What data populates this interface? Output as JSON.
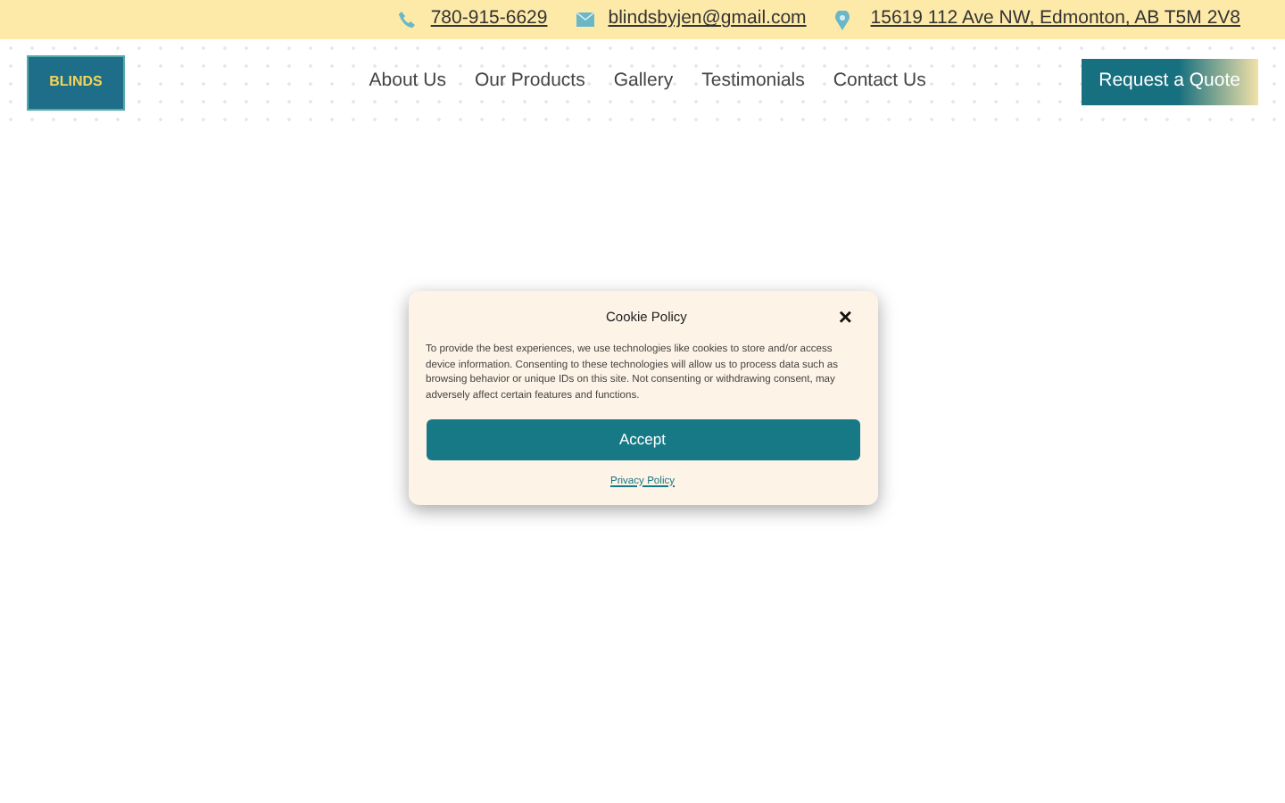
{
  "top_bar": {
    "phone": "780-915-6629",
    "email": "blindsbyjen@gmail.com",
    "address": "15619 112 Ave NW, Edmonton, AB T5M 2V8"
  },
  "logo": {
    "text": "BLINDS"
  },
  "nav": [
    {
      "label": "About Us"
    },
    {
      "label": "Our Products"
    },
    {
      "label": "Gallery"
    },
    {
      "label": "Testimonials"
    },
    {
      "label": "Contact Us"
    }
  ],
  "cta_button": "Request a Quote",
  "cookie_dialog": {
    "title": "Cookie Policy",
    "close": "×",
    "body": "To provide the best experiences, we use technologies like cookies to store and/or access device information. Consenting to these technologies will allow us to process data such as browsing behavior or unique IDs on this site. Not consenting or withdrawing consent, may adversely affect certain features and functions.",
    "accept": "Accept",
    "link": "Privacy Policy"
  }
}
